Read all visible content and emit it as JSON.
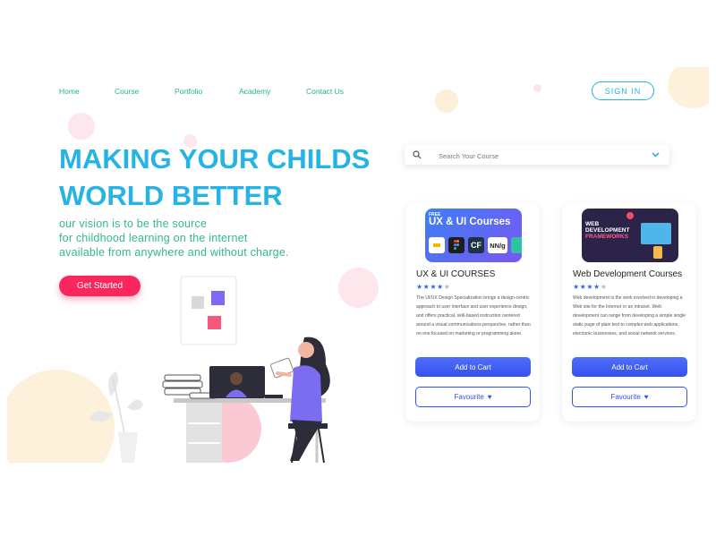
{
  "nav": {
    "items": [
      {
        "label": "Home"
      },
      {
        "label": "Course"
      },
      {
        "label": "Portfolio"
      },
      {
        "label": "Academy"
      },
      {
        "label": "Contact Us"
      }
    ],
    "signin_label": "SIGN IN"
  },
  "hero": {
    "title_line1": "MAKING YOUR CHILDS",
    "title_line2": "WORLD BETTER",
    "subtitle_line1": "our vision is to be the source",
    "subtitle_line2": "for childhood learning on the internet",
    "subtitle_line3": "available from anywhere and without charge.",
    "cta_label": "Get Started"
  },
  "search": {
    "placeholder": "Search Your Course",
    "icon": "search-icon",
    "dropdown_icon": "chevron-down-icon"
  },
  "courses": [
    {
      "image_badge": "FREE",
      "image_title": "UX & UI Courses",
      "image_logo_text": "NN/g",
      "title": "UX & UI COURSES",
      "rating": 4,
      "rating_max": 5,
      "description": "The UI/UX Design Specialization brings a design-centric approach to user interface and user experience design, and offers practical, skill-based instruction centered around a visual communications perspective, rather than on one focused on marketing or programming alone.",
      "cart_label": "Add to Cart",
      "fav_label": "Favourite"
    },
    {
      "image_title_line1": "WEB",
      "image_title_line2": "DEVELOPMENT",
      "image_title_line3": "FRAMEWORKS",
      "title": "Web Development Courses",
      "rating": 4,
      "rating_max": 5,
      "description": "Web development is the work involved in developing a Web site for the Internet or an intranet. Web development can range from developing a simple single static page of plain text to complex web applications, electronic businesses, and social network services.",
      "cart_label": "Add to Cart",
      "fav_label": "Favourite"
    }
  ],
  "colors": {
    "accent": "#26b3e6",
    "nav": "#21b58f",
    "cta": "#f9275d",
    "primary_button": "#3550ee",
    "star": "#3d63f2"
  }
}
